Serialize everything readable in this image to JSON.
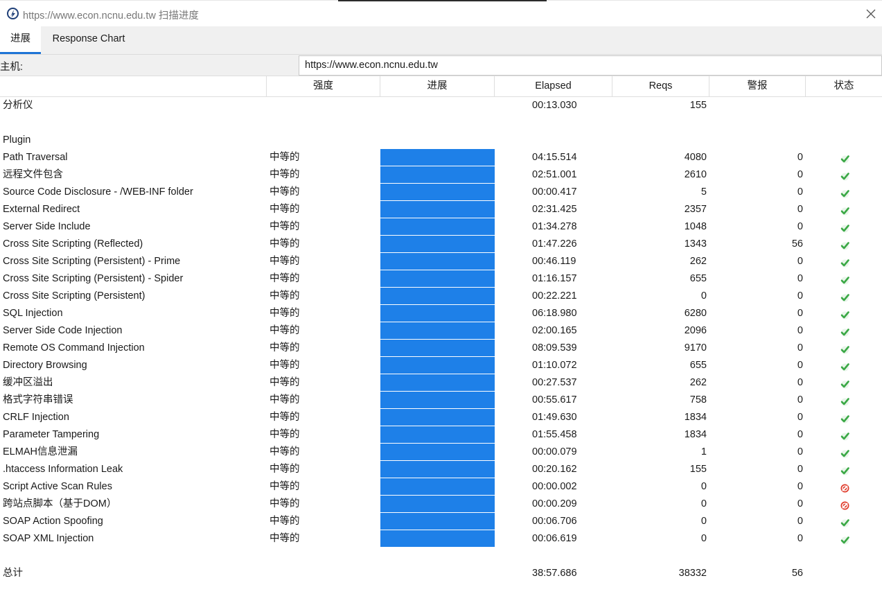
{
  "window": {
    "title": "https://www.econ.ncnu.edu.tw 扫描进度"
  },
  "tabs": [
    "进展",
    "Response Chart"
  ],
  "host": {
    "label": "主机:",
    "value": "https://www.econ.ncnu.edu.tw"
  },
  "columns": {
    "strength": "强度",
    "progress": "进展",
    "elapsed": "Elapsed",
    "reqs": "Reqs",
    "alerts": "警报",
    "status": "状态"
  },
  "analyser": {
    "name": "分析仪",
    "elapsed": "00:13.030",
    "reqs": "155"
  },
  "plugin_heading": "Plugin",
  "plugins": [
    {
      "name": "Path Traversal",
      "strength": "中等的",
      "progress": 1,
      "elapsed": "04:15.514",
      "reqs": "4080",
      "alerts": "0",
      "status": "completed-icon"
    },
    {
      "name": "远程文件包含",
      "strength": "中等的",
      "progress": 1,
      "elapsed": "02:51.001",
      "reqs": "2610",
      "alerts": "0",
      "status": "completed-icon"
    },
    {
      "name": "Source Code Disclosure - /WEB-INF folder",
      "strength": "中等的",
      "progress": 1,
      "elapsed": "00:00.417",
      "reqs": "5",
      "alerts": "0",
      "status": "completed-icon"
    },
    {
      "name": "External Redirect",
      "strength": "中等的",
      "progress": 1,
      "elapsed": "02:31.425",
      "reqs": "2357",
      "alerts": "0",
      "status": "completed-icon"
    },
    {
      "name": "Server Side Include",
      "strength": "中等的",
      "progress": 1,
      "elapsed": "01:34.278",
      "reqs": "1048",
      "alerts": "0",
      "status": "completed-icon"
    },
    {
      "name": "Cross Site Scripting (Reflected)",
      "strength": "中等的",
      "progress": 1,
      "elapsed": "01:47.226",
      "reqs": "1343",
      "alerts": "56",
      "status": "completed-icon"
    },
    {
      "name": "Cross Site Scripting (Persistent) - Prime",
      "strength": "中等的",
      "progress": 1,
      "elapsed": "00:46.119",
      "reqs": "262",
      "alerts": "0",
      "status": "completed-icon"
    },
    {
      "name": "Cross Site Scripting (Persistent) - Spider",
      "strength": "中等的",
      "progress": 1,
      "elapsed": "01:16.157",
      "reqs": "655",
      "alerts": "0",
      "status": "completed-icon"
    },
    {
      "name": "Cross Site Scripting (Persistent)",
      "strength": "中等的",
      "progress": 1,
      "elapsed": "00:22.221",
      "reqs": "0",
      "alerts": "0",
      "status": "completed-icon"
    },
    {
      "name": "SQL Injection",
      "strength": "中等的",
      "progress": 1,
      "elapsed": "06:18.980",
      "reqs": "6280",
      "alerts": "0",
      "status": "completed-icon"
    },
    {
      "name": "Server Side Code Injection",
      "strength": "中等的",
      "progress": 1,
      "elapsed": "02:00.165",
      "reqs": "2096",
      "alerts": "0",
      "status": "completed-icon"
    },
    {
      "name": "Remote OS Command Injection",
      "strength": "中等的",
      "progress": 1,
      "elapsed": "08:09.539",
      "reqs": "9170",
      "alerts": "0",
      "status": "completed-icon"
    },
    {
      "name": "Directory Browsing",
      "strength": "中等的",
      "progress": 1,
      "elapsed": "01:10.072",
      "reqs": "655",
      "alerts": "0",
      "status": "completed-icon"
    },
    {
      "name": "缓冲区溢出",
      "strength": "中等的",
      "progress": 1,
      "elapsed": "00:27.537",
      "reqs": "262",
      "alerts": "0",
      "status": "completed-icon"
    },
    {
      "name": "格式字符串错误",
      "strength": "中等的",
      "progress": 1,
      "elapsed": "00:55.617",
      "reqs": "758",
      "alerts": "0",
      "status": "completed-icon"
    },
    {
      "name": "CRLF Injection",
      "strength": "中等的",
      "progress": 1,
      "elapsed": "01:49.630",
      "reqs": "1834",
      "alerts": "0",
      "status": "completed-icon"
    },
    {
      "name": "Parameter Tampering",
      "strength": "中等的",
      "progress": 1,
      "elapsed": "01:55.458",
      "reqs": "1834",
      "alerts": "0",
      "status": "completed-icon"
    },
    {
      "name": "ELMAH信息泄漏",
      "strength": "中等的",
      "progress": 1,
      "elapsed": "00:00.079",
      "reqs": "1",
      "alerts": "0",
      "status": "completed-icon"
    },
    {
      "name": ".htaccess Information Leak",
      "strength": "中等的",
      "progress": 1,
      "elapsed": "00:20.162",
      "reqs": "155",
      "alerts": "0",
      "status": "completed-icon"
    },
    {
      "name": "Script Active Scan Rules",
      "strength": "中等的",
      "progress": 1,
      "elapsed": "00:00.002",
      "reqs": "0",
      "alerts": "0",
      "status": "skipped-icon"
    },
    {
      "name": "跨站点脚本（基于DOM）",
      "strength": "中等的",
      "progress": 1,
      "elapsed": "00:00.209",
      "reqs": "0",
      "alerts": "0",
      "status": "skipped-icon"
    },
    {
      "name": "SOAP Action Spoofing",
      "strength": "中等的",
      "progress": 1,
      "elapsed": "00:06.706",
      "reqs": "0",
      "alerts": "0",
      "status": "completed-icon"
    },
    {
      "name": "SOAP XML Injection",
      "strength": "中等的",
      "progress": 1,
      "elapsed": "00:06.619",
      "reqs": "0",
      "alerts": "0",
      "status": "completed-icon"
    }
  ],
  "total": {
    "label": "总计",
    "elapsed": "38:57.686",
    "reqs": "38332",
    "alerts": "56"
  },
  "colors": {
    "progress_bar": "#1e80e8",
    "ok": "#3aa845",
    "skipped": "#e03a2a",
    "tab_accent": "#1d74d6"
  }
}
